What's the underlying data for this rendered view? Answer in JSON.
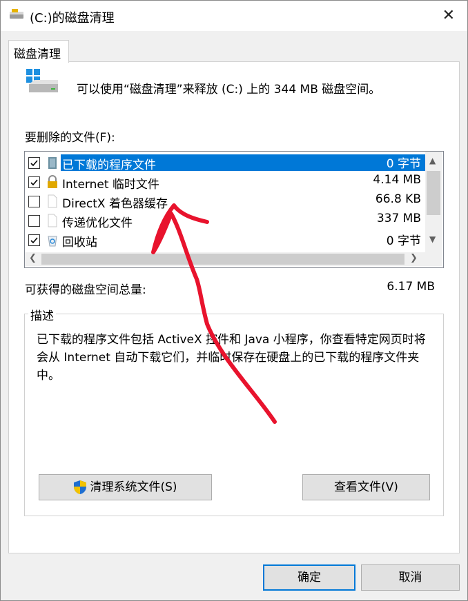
{
  "window": {
    "title": "(C:)的磁盘清理",
    "close_glyph": "✕"
  },
  "tab": {
    "label": "磁盘清理"
  },
  "header": {
    "text": "可以使用“磁盘清理”来释放  (C:) 上的 344 MB 磁盘空间。"
  },
  "files": {
    "label": "要删除的文件(F):",
    "items": [
      {
        "name": "已下载的程序文件",
        "size": "0 字节",
        "checked": true,
        "selected": true,
        "icon": "folder-icon"
      },
      {
        "name": "Internet 临时文件",
        "size": "4.14 MB",
        "checked": true,
        "selected": false,
        "icon": "lock-icon"
      },
      {
        "name": "DirectX 着色器缓存",
        "size": "66.8 KB",
        "checked": false,
        "selected": false,
        "icon": "file-icon"
      },
      {
        "name": "传递优化文件",
        "size": "337 MB",
        "checked": false,
        "selected": false,
        "icon": "file-icon"
      },
      {
        "name": "回收站",
        "size": "0 字节",
        "checked": true,
        "selected": false,
        "icon": "recycle-bin-icon"
      }
    ]
  },
  "total": {
    "label": "可获得的磁盘空间总量:",
    "value": "6.17 MB"
  },
  "description": {
    "legend": "描述",
    "text": "已下载的程序文件包括 ActiveX 控件和 Java 小程序，你查看特定网页时将会从 Internet 自动下载它们，并临时保存在硬盘上的已下载的程序文件夹中。"
  },
  "buttons": {
    "cleanup_system": "清理系统文件(S)",
    "view_files": "查看文件(V)",
    "ok": "确定",
    "cancel": "取消"
  },
  "colors": {
    "selection": "#0078d7",
    "annotation": "#e8132d"
  }
}
